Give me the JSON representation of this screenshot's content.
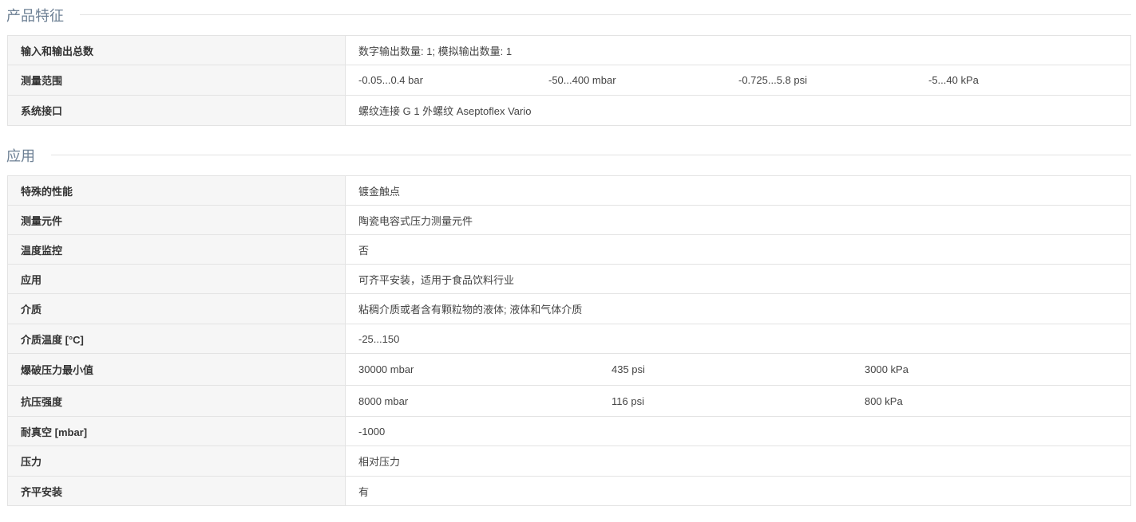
{
  "section1": {
    "title": "产品特征",
    "rows": [
      {
        "label": "输入和输出总数",
        "values": [
          "数字输出数量: 1; 模拟输出数量: 1"
        ]
      },
      {
        "label": "测量范围",
        "values": [
          "-0.05...0.4 bar",
          "-50...400 mbar",
          "-0.725...5.8 psi",
          "-5...40 kPa"
        ]
      },
      {
        "label": "系统接口",
        "values": [
          "螺纹连接 G 1 外螺纹 Aseptoflex Vario"
        ]
      }
    ]
  },
  "section2": {
    "title": "应用",
    "rows": [
      {
        "label": "特殊的性能",
        "values": [
          "镀金触点"
        ]
      },
      {
        "label": "测量元件",
        "values": [
          "陶瓷电容式压力测量元件"
        ]
      },
      {
        "label": "温度监控",
        "values": [
          "否"
        ]
      },
      {
        "label": "应用",
        "values": [
          "可齐平安装，适用于食品饮料行业"
        ]
      },
      {
        "label": "介质",
        "values": [
          "粘稠介质或者含有颗粒物的液体; 液体和气体介质"
        ]
      },
      {
        "label": "介质温度 [°C]",
        "values": [
          "-25...150"
        ]
      },
      {
        "label": "爆破压力最小值",
        "values": [
          "30000 mbar",
          "435 psi",
          "3000 kPa"
        ]
      },
      {
        "label": "抗压强度",
        "values": [
          "8000 mbar",
          "116 psi",
          "800 kPa"
        ]
      },
      {
        "label": "耐真空 [mbar]",
        "values": [
          "-1000"
        ]
      },
      {
        "label": "压力",
        "values": [
          "相对压力"
        ]
      },
      {
        "label": "齐平安装",
        "values": [
          "有"
        ]
      }
    ]
  }
}
